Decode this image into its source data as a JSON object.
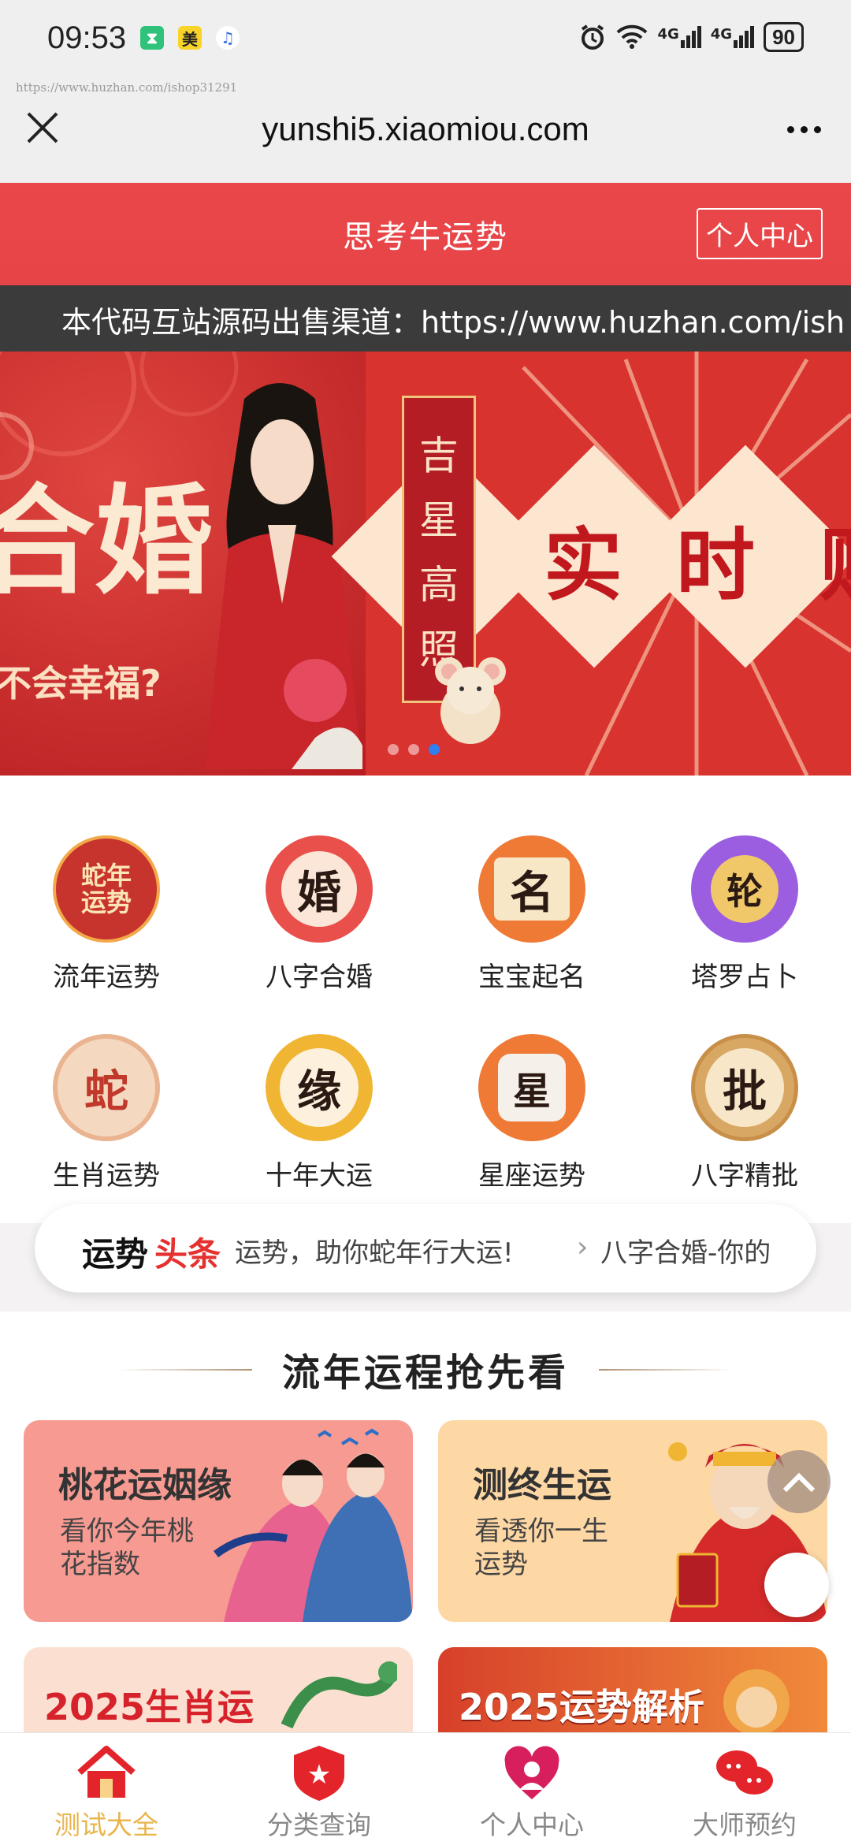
{
  "status_bar": {
    "time": "09:53",
    "app_icons": [
      "hourglass-app-icon",
      "meituan-app-icon",
      "music-app-icon"
    ],
    "meituan_glyph": "美",
    "network_1": "4G",
    "network_2": "4G",
    "battery": "90"
  },
  "watermark": "https://www.huzhan.com/ishop31291",
  "browser": {
    "url": "yunshi5.xiaomiou.com"
  },
  "header": {
    "title": "思考牛运势",
    "button": "个人中心"
  },
  "ticker": {
    "text": "本代码互站源码出售渠道：https://www.huzhan.com/ish"
  },
  "banner": {
    "left_big": "合婚",
    "left_sub": "不会幸福?",
    "right_vertical": [
      "吉",
      "星",
      "高",
      "照"
    ],
    "right_big": [
      "实",
      "时",
      "财"
    ],
    "dots": 3,
    "active_dot": 3
  },
  "grid": {
    "items": [
      {
        "label": "流年运势",
        "glyph": "蛇年运势",
        "icon": "snake-year-icon",
        "bg": "#c7332d",
        "fg": "#fbe4b5"
      },
      {
        "label": "八字合婚",
        "glyph": "婚",
        "icon": "marriage-icon",
        "bg": "#e9504b",
        "fg": "#2b1a14"
      },
      {
        "label": "宝宝起名",
        "glyph": "名",
        "icon": "baby-name-icon",
        "bg": "#ef7a36",
        "fg": "#2b1a14"
      },
      {
        "label": "塔罗占卜",
        "glyph": "轮",
        "icon": "tarot-icon",
        "bg": "#9b5ee0",
        "fg": "#2b1a14"
      },
      {
        "label": "生肖运势",
        "glyph": "蛇",
        "icon": "zodiac-snake-icon",
        "bg": "#f5c8a8",
        "fg": "#c0392b"
      },
      {
        "label": "十年大运",
        "glyph": "缘",
        "icon": "decade-fortune-icon",
        "bg": "#f0b532",
        "fg": "#2b1a14"
      },
      {
        "label": "星座运势",
        "glyph": "星",
        "icon": "constellation-icon",
        "bg": "#ef7a36",
        "fg": "#2b1a14"
      },
      {
        "label": "八字精批",
        "glyph": "批",
        "icon": "bazi-analysis-icon",
        "bg": "#d9a764",
        "fg": "#2b1a14"
      }
    ]
  },
  "news": {
    "tag_part1": "运势",
    "tag_part2": "头条",
    "item1": "运势，助你蛇年行大运!",
    "item2": "八字合婚-你的"
  },
  "section": {
    "title": "流年运程抢先看"
  },
  "cards": [
    {
      "title": "桃花运姻缘",
      "subtitle": "看你今年桃花指数",
      "bg": "#f79a92"
    },
    {
      "title": "测终生运",
      "subtitle": "看透你一生运势",
      "bg": "#fdd7a4"
    },
    {
      "title": "2025生肖运",
      "bg": "#fbe0d2"
    },
    {
      "title": "2025运势解析",
      "bg": "#e3622a"
    }
  ],
  "tabbar": {
    "tabs": [
      {
        "label": "测试大全",
        "icon": "home-icon",
        "active": true
      },
      {
        "label": "分类查询",
        "icon": "category-badge-icon",
        "active": false
      },
      {
        "label": "个人中心",
        "icon": "profile-heart-icon",
        "active": false
      },
      {
        "label": "大师预约",
        "icon": "chat-bubbles-icon",
        "active": false
      }
    ]
  },
  "colors": {
    "brand_red": "#e64446",
    "ticker_bg": "#3b3b3b",
    "tab_active": "#e9b44c",
    "tab_inactive": "#888888"
  }
}
